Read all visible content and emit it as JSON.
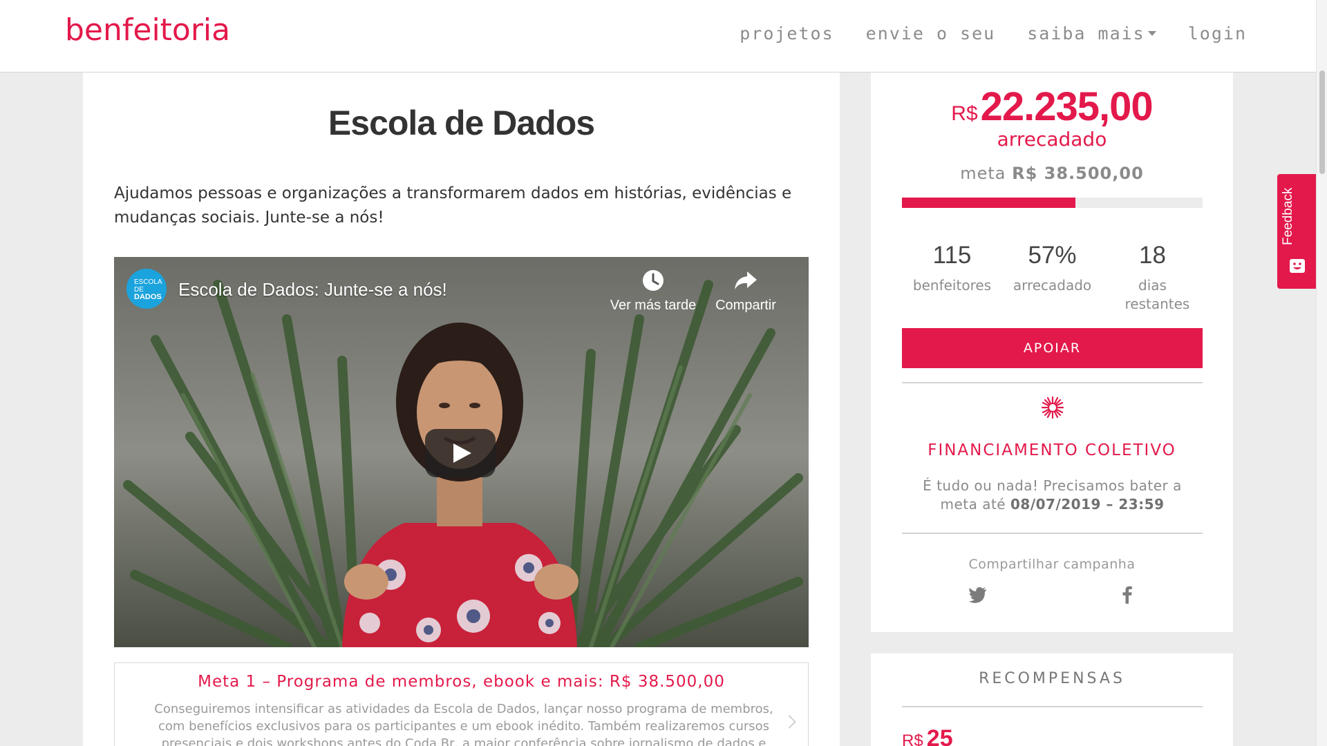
{
  "header": {
    "logo_text": "benfeitoria",
    "nav": [
      "projetos",
      "envie o seu",
      "saiba mais",
      "login"
    ]
  },
  "campaign": {
    "title": "Escola de Dados",
    "intro": "Ajudamos pessoas e organizações a transformarem dados em histórias, evidências e mudanças sociais. Junte-se a nós!"
  },
  "video": {
    "title": "Escola de Dados: Junte-se a nós!",
    "channel_line1": "ESCOLA",
    "channel_line2": "DE",
    "channel_line3": "DADOS",
    "watch_later": "Ver más tarde",
    "share": "Compartir"
  },
  "goal": {
    "title": "Meta 1 – Programa de membros, ebook e mais: R$ 38.500,00",
    "description": "Conseguiremos intensificar as atividades da Escola de Dados, lançar nosso programa de membros, com benefícios exclusivos para os participantes e um ebook inédito. Também realizaremos cursos presenciais e dois workshops antes do Coda.Br, a maior conferência sobre jornalismo de dados e métodos digitais do"
  },
  "funding": {
    "currency": "R$",
    "raised": "22.235,00",
    "raised_label": "arrecadado",
    "goal_label": "meta",
    "goal_value": "R$ 38.500,00",
    "progress_fraction": 0.578,
    "stats": [
      {
        "value": "115",
        "label": "benfeitores"
      },
      {
        "value": "57%",
        "label": "arrecadado"
      },
      {
        "value": "18",
        "label": "dias restantes"
      }
    ],
    "button": "APOIAR",
    "model_title": "FINANCIAMENTO COLETIVO",
    "model_desc": "É tudo ou nada! Precisamos bater a meta até",
    "deadline": "08/07/2019 – 23:59",
    "share_label": "Compartilhar campanha"
  },
  "rewards": {
    "title": "RECOMPENSAS",
    "first_currency": "R$",
    "first_value": "25"
  },
  "feedback": {
    "label": "Feedback"
  },
  "colors": {
    "brand": "#e3194b",
    "text": "#333333",
    "muted": "#8c8c8c"
  }
}
